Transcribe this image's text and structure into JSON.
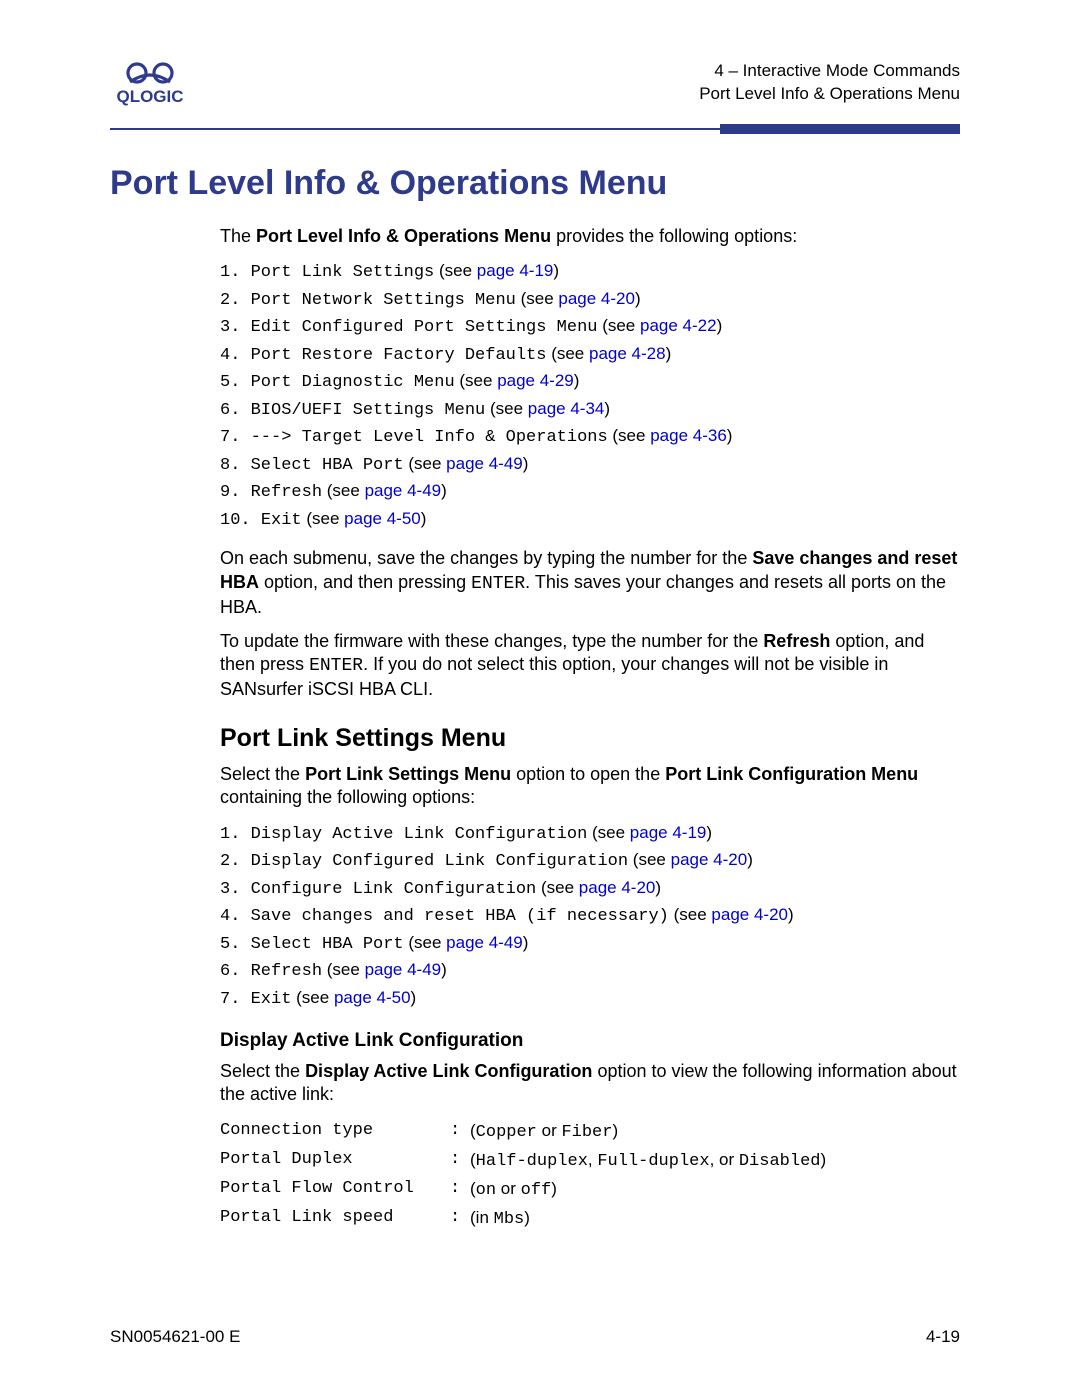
{
  "header": {
    "logo_text": "QLOGIC",
    "line1": "4 – Interactive Mode Commands",
    "line2": "Port Level Info & Operations Menu"
  },
  "h1": "Port Level Info & Operations Menu",
  "intro_prefix": "The ",
  "intro_bold": "Port Level Info & Operations Menu",
  "intro_suffix": " provides the following options:",
  "menu1": [
    {
      "n": "1.",
      "txt": "Port Link Settings",
      "suffix": " (see ",
      "link": "page 4-19",
      "end": ")"
    },
    {
      "n": "2.",
      "txt": "Port Network Settings Menu",
      "suffix": " (see ",
      "link": "page 4-20",
      "end": ")"
    },
    {
      "n": "3.",
      "txt": "Edit Configured Port Settings Menu",
      "suffix": " (see ",
      "link": "page 4-22",
      "end": ")"
    },
    {
      "n": "4.",
      "txt": "Port Restore Factory Defaults",
      "suffix": " (see ",
      "link": "page 4-28",
      "end": ")"
    },
    {
      "n": "5.",
      "txt": "Port Diagnostic Menu",
      "suffix": " (see ",
      "link": "page 4-29",
      "end": ")"
    },
    {
      "n": "6.",
      "txt": "BIOS/UEFI Settings Menu",
      "suffix": " (see ",
      "link": "page 4-34",
      "end": ")"
    },
    {
      "n": "7.",
      "txt": "---> Target Level Info & Operations",
      "suffix": " (see ",
      "link": "page 4-36",
      "end": ")"
    },
    {
      "n": "8.",
      "txt": "Select HBA Port",
      "suffix": " (see ",
      "link": "page 4-49",
      "end": ")"
    },
    {
      "n": "9.",
      "txt": "Refresh",
      "suffix": " (see ",
      "link": "page 4-49",
      "end": ")"
    },
    {
      "n": "10.",
      "txt": "Exit",
      "suffix": " (see ",
      "link": "page 4-50",
      "end": ")"
    }
  ],
  "p1a": "On each submenu, save the changes by typing the number for the ",
  "p1b": "Save changes and reset HBA",
  "p1c": " option, and then pressing ",
  "p1d": "ENTER",
  "p1e": ". This saves your changes and resets all ports on the HBA.",
  "p2a": "To update the firmware with these changes, type the number for the ",
  "p2b": "Refresh",
  "p2c": " option, and then press ",
  "p2d": "ENTER",
  "p2e": ". If you do not select this option, your changes will not be visible in SANsurfer iSCSI HBA CLI.",
  "h2": "Port Link Settings Menu",
  "p3a": "Select the ",
  "p3b": "Port Link Settings Menu",
  "p3c": " option to open the ",
  "p3d": "Port Link Configuration Menu",
  "p3e": " containing the following options:",
  "menu2": [
    {
      "n": "1.",
      "txt": "Display Active Link Configuration",
      "suffix": " (see ",
      "link": "page 4-19",
      "end": ")"
    },
    {
      "n": "2.",
      "txt": "Display Configured Link Configuration",
      "suffix": " (see ",
      "link": "page 4-20",
      "end": ")"
    },
    {
      "n": "3.",
      "txt": "Configure Link Configuration",
      "suffix": " (see ",
      "link": "page 4-20",
      "end": ")"
    },
    {
      "n": "4.",
      "txt": "Save changes and reset HBA (if necessary)",
      "suffix": " (see ",
      "link": "page 4-20",
      "end": ")"
    },
    {
      "n": "5.",
      "txt": "Select HBA Port",
      "suffix": " (see ",
      "link": "page 4-49",
      "end": ")"
    },
    {
      "n": "6.",
      "txt": "Refresh",
      "suffix": " (see ",
      "link": "page 4-49",
      "end": ")"
    },
    {
      "n": "7.",
      "txt": "Exit",
      "suffix": " (see ",
      "link": "page 4-50",
      "end": ")"
    }
  ],
  "h3": "Display Active Link Configuration",
  "p4a": "Select the ",
  "p4b": "Display Active Link Configuration",
  "p4c": " option to view the following information about the active link:",
  "kv": [
    {
      "key": "Connection type",
      "parts": [
        "(",
        "Copper",
        " or ",
        "Fiber",
        ")"
      ]
    },
    {
      "key": "Portal Duplex",
      "parts": [
        "(",
        "Half-duplex",
        ", ",
        "Full-duplex",
        ", or ",
        "Disabled",
        ")"
      ]
    },
    {
      "key": "Portal Flow Control",
      "parts": [
        "(",
        "on",
        " or ",
        "off",
        ")"
      ]
    },
    {
      "key": "Portal Link speed",
      "parts": [
        "(",
        "",
        "in ",
        "Mbs",
        ")"
      ]
    }
  ],
  "footer": {
    "left": "SN0054621-00 E",
    "right": "4-19"
  }
}
